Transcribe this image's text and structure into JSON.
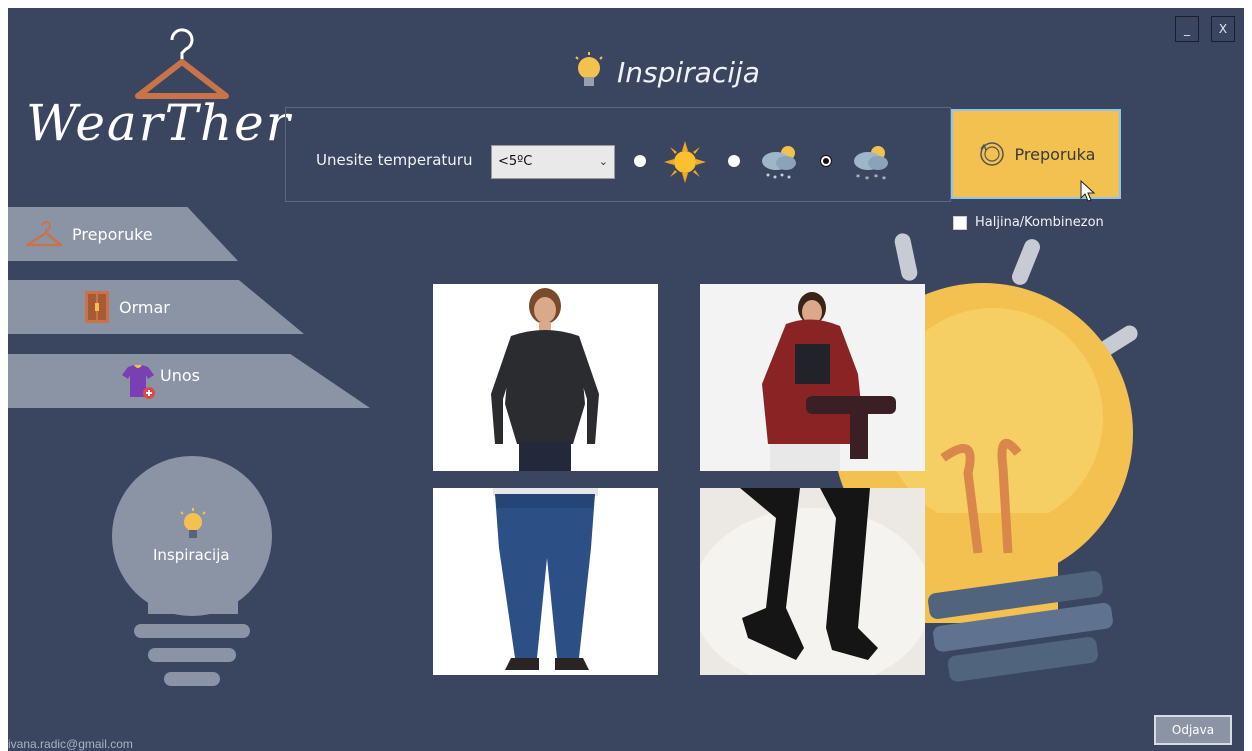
{
  "window": {
    "minimize_label": "_",
    "close_label": "X"
  },
  "brand": {
    "name": "WearTher",
    "icon": "hanger-icon"
  },
  "title": {
    "text": "Inspiracija",
    "icon": "lightbulb-icon"
  },
  "sidebar": {
    "items": [
      {
        "label": "Preporuke",
        "icon": "hanger-icon"
      },
      {
        "label": "Ormar",
        "icon": "wardrobe-icon"
      },
      {
        "label": "Unos",
        "icon": "add-shirt-icon"
      }
    ],
    "inspiration_label": "Inspiracija"
  },
  "temperature": {
    "label": "Unesite temperaturu",
    "selected": "<5ºC",
    "weather_options": [
      {
        "icon": "sun-icon",
        "selected": false
      },
      {
        "icon": "rain-cloud-icon",
        "selected": false
      },
      {
        "icon": "snow-cloud-icon",
        "selected": true
      }
    ]
  },
  "recommend_button": {
    "label": "Preporuka",
    "icon": "refresh-icon"
  },
  "dress_checkbox": {
    "label": "Haljina/Kombinezon",
    "checked": false
  },
  "outfit_images": [
    {
      "icon": "black-sweater-photo"
    },
    {
      "icon": "red-puffer-jacket-photo"
    },
    {
      "icon": "blue-jeans-photo"
    },
    {
      "icon": "black-boots-photo"
    }
  ],
  "footer": {
    "email": "ivana.radic@gmail.com",
    "logout_label": "Odjava"
  },
  "colors": {
    "background": "#3a465f",
    "nav": "#8a94a5",
    "accent": "#f2c14f",
    "hanger": "#c8734a"
  }
}
